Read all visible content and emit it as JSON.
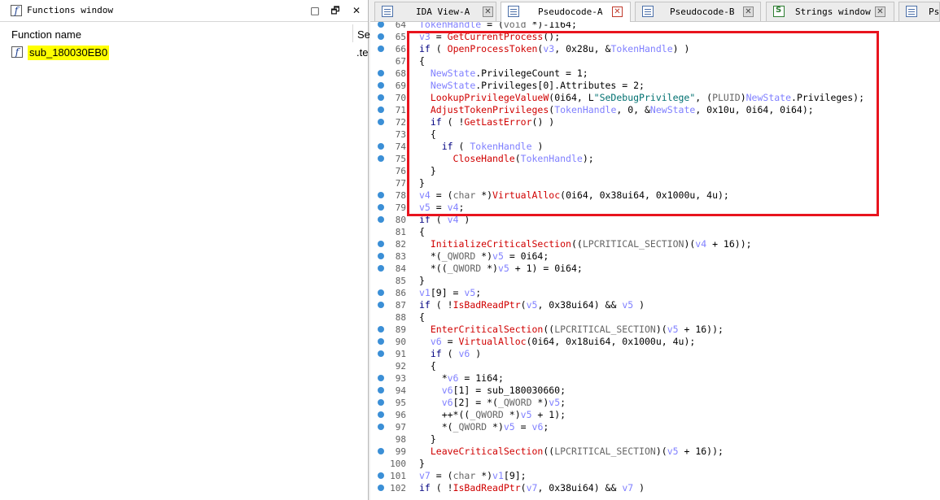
{
  "functions_window": {
    "title": "Functions window",
    "controls": {
      "pin": "□",
      "float": "🗗",
      "close": "✕"
    },
    "columns": [
      "Function name",
      "Se"
    ],
    "rows": [
      {
        "name": "sub_180030EB0",
        "segment": ".te"
      }
    ],
    "icon_letter": "f"
  },
  "tabs": [
    {
      "label": "IDA View-A",
      "icon": "view-icon",
      "active": false
    },
    {
      "label": "Pseudocode-A",
      "icon": "pseudocode-icon",
      "active": true
    },
    {
      "label": "Pseudocode-B",
      "icon": "pseudocode-icon",
      "active": false
    },
    {
      "label": "Strings window",
      "icon": "strings-icon",
      "active": false
    },
    {
      "label": "Ps",
      "icon": "pseudocode-icon",
      "active": false
    }
  ],
  "code": {
    "lines": [
      {
        "n": "64",
        "html": "<span class=\"vi\">TokenHandle</span> = (<span class=\"t\">void</span> *)-1i64;"
      },
      {
        "n": "65",
        "html": "<span class=\"vi\">v3</span> = <span class=\"fn\">GetCurrentProcess</span>();"
      },
      {
        "n": "66",
        "html": "<span class=\"k\">if</span> ( <span class=\"fn\">OpenProcessToken</span>(<span class=\"vi\">v3</span>, 0x28u, &amp;<span class=\"vi\">TokenHandle</span>) )"
      },
      {
        "n": "67",
        "html": "{"
      },
      {
        "n": "68",
        "html": "  <span class=\"vi\">NewState</span>.PrivilegeCount = 1;"
      },
      {
        "n": "69",
        "html": "  <span class=\"vi\">NewState</span>.Privileges[0].Attributes = 2;"
      },
      {
        "n": "70",
        "html": "  <span class=\"fn\">LookupPrivilegeValueW</span>(0i64, L<span class=\"s\">\"SeDebugPrivilege\"</span>, (<span class=\"t\">PLUID</span>)<span class=\"vi\">NewState</span>.Privileges);"
      },
      {
        "n": "71",
        "html": "  <span class=\"fn\">AdjustTokenPrivileges</span>(<span class=\"vi\">TokenHandle</span>, 0, &amp;<span class=\"vi\">NewState</span>, 0x10u, 0i64, 0i64);"
      },
      {
        "n": "72",
        "html": "  <span class=\"k\">if</span> ( !<span class=\"fn\">GetLastError</span>() )"
      },
      {
        "n": "73",
        "html": "  {"
      },
      {
        "n": "74",
        "html": "    <span class=\"k\">if</span> ( <span class=\"vi\">TokenHandle</span> )"
      },
      {
        "n": "75",
        "html": "      <span class=\"fn\">CloseHandle</span>(<span class=\"vi\">TokenHandle</span>);"
      },
      {
        "n": "76",
        "html": "  }"
      },
      {
        "n": "77",
        "html": "}"
      },
      {
        "n": "78",
        "html": "<span class=\"vi\">v4</span> = (<span class=\"t\">char</span> *)<span class=\"fn\">VirtualAlloc</span>(0i64, 0x38ui64, 0x1000u, 4u);"
      },
      {
        "n": "79",
        "html": "<span class=\"vi\">v5</span> = <span class=\"vi\">v4</span>;"
      },
      {
        "n": "80",
        "html": "<span class=\"k\">if</span> ( <span class=\"vi\">v4</span> )"
      },
      {
        "n": "81",
        "html": "{"
      },
      {
        "n": "82",
        "html": "  <span class=\"fn\">InitializeCriticalSection</span>((<span class=\"t\">LPCRITICAL_SECTION</span>)(<span class=\"vi\">v4</span> + 16));"
      },
      {
        "n": "83",
        "html": "  *(<span class=\"t\">_QWORD</span> *)<span class=\"vi\">v5</span> = 0i64;"
      },
      {
        "n": "84",
        "html": "  *((<span class=\"t\">_QWORD</span> *)<span class=\"vi\">v5</span> + 1) = 0i64;"
      },
      {
        "n": "85",
        "html": "}"
      },
      {
        "n": "86",
        "html": "<span class=\"vi\">v1</span>[9] = <span class=\"vi\">v5</span>;"
      },
      {
        "n": "87",
        "html": "<span class=\"k\">if</span> ( !<span class=\"fn\">IsBadReadPtr</span>(<span class=\"vi\">v5</span>, 0x38ui64) &amp;&amp; <span class=\"vi\">v5</span> )"
      },
      {
        "n": "88",
        "html": "{"
      },
      {
        "n": "89",
        "html": "  <span class=\"fn\">EnterCriticalSection</span>((<span class=\"t\">LPCRITICAL_SECTION</span>)(<span class=\"vi\">v5</span> + 16));"
      },
      {
        "n": "90",
        "html": "  <span class=\"vi\">v6</span> = <span class=\"fn\">VirtualAlloc</span>(0i64, 0x18ui64, 0x1000u, 4u);"
      },
      {
        "n": "91",
        "html": "  <span class=\"k\">if</span> ( <span class=\"vi\">v6</span> )"
      },
      {
        "n": "92",
        "html": "  {"
      },
      {
        "n": "93",
        "html": "    *<span class=\"vi\">v6</span> = 1i64;"
      },
      {
        "n": "94",
        "html": "    <span class=\"vi\">v6</span>[1] = sub_180030660;"
      },
      {
        "n": "95",
        "html": "    <span class=\"vi\">v6</span>[2] = *(<span class=\"t\">_QWORD</span> *)<span class=\"vi\">v5</span>;"
      },
      {
        "n": "96",
        "html": "    ++*((<span class=\"t\">_QWORD</span> *)<span class=\"vi\">v5</span> + 1);"
      },
      {
        "n": "97",
        "html": "    *(<span class=\"t\">_QWORD</span> *)<span class=\"vi\">v5</span> = <span class=\"vi\">v6</span>;"
      },
      {
        "n": "98",
        "html": "  }"
      },
      {
        "n": "99",
        "html": "  <span class=\"fn\">LeaveCriticalSection</span>((<span class=\"t\">LPCRITICAL_SECTION</span>)(<span class=\"vi\">v5</span> + 16));"
      },
      {
        "n": "100",
        "html": "}"
      },
      {
        "n": "101",
        "html": "<span class=\"vi\">v7</span> = (<span class=\"t\">char</span> *)<span class=\"vi\">v1</span>[9];"
      },
      {
        "n": "102",
        "html": "<span class=\"k\">if</span> ( !<span class=\"fn\">IsBadReadPtr</span>(<span class=\"vi\">v7</span>, 0x38ui64) &amp;&amp; <span class=\"vi\">v7</span> )"
      }
    ],
    "dotless_lines": [
      "67",
      "73",
      "76",
      "77",
      "81",
      "85",
      "88",
      "92",
      "98",
      "100"
    ]
  },
  "colors": {
    "highlight_box": "#e8141e",
    "selection": "#ffff00",
    "breakpoint_dot": "#3b8fd6"
  }
}
